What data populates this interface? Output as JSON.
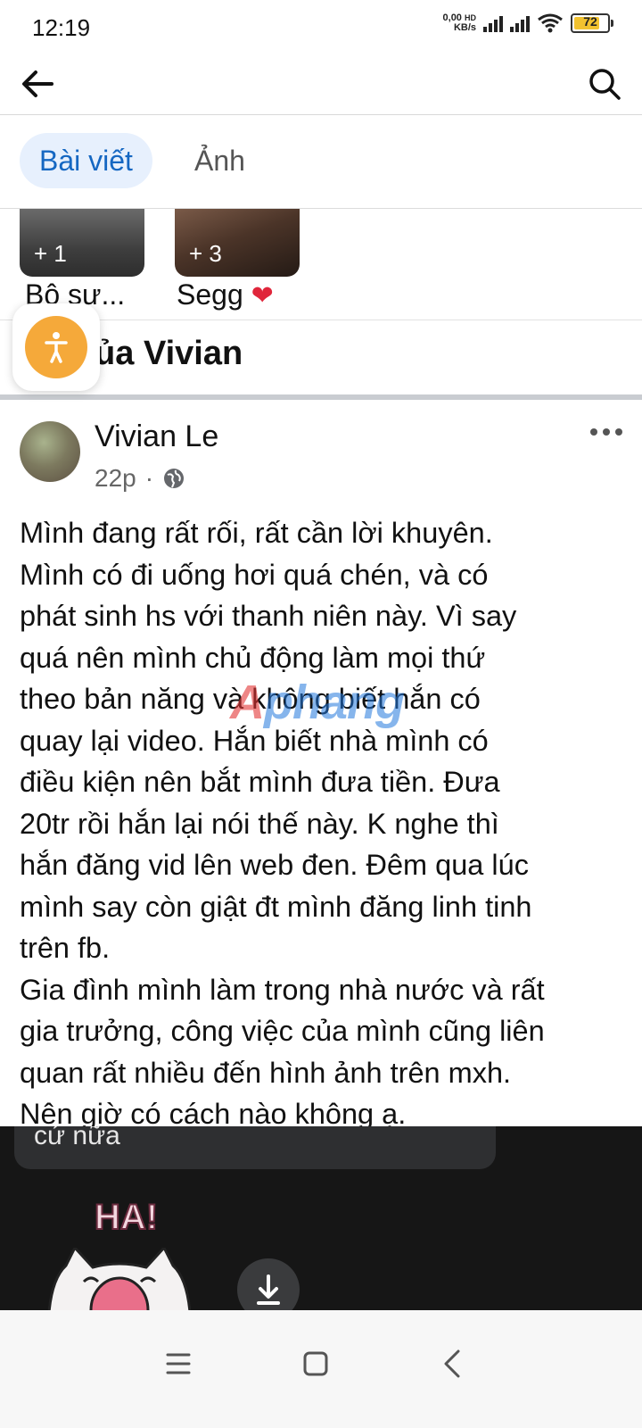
{
  "status_bar": {
    "time": "12:19",
    "net_speed_value": "0,00",
    "net_speed_unit": "KB/s",
    "network_type": "HD",
    "battery": "72",
    "icons": [
      "signal-icon",
      "signal-icon",
      "wifi-icon",
      "battery-icon"
    ]
  },
  "topbar": {
    "icons": [
      "back-arrow-icon",
      "search-icon"
    ]
  },
  "tabs": [
    {
      "label": "Bài viết",
      "active": true
    },
    {
      "label": "Ảnh",
      "active": false
    }
  ],
  "albums": [
    {
      "count": "+ 1",
      "name": "Bộ sư..."
    },
    {
      "count": "+ 3",
      "name": "Segg"
    }
  ],
  "section": {
    "title": "iết của Vivian"
  },
  "post": {
    "author": "Vivian Le",
    "time": "22p",
    "separator": "·",
    "privacy": "public",
    "body": "Mình đang rất rối, rất cần lời khuyên.\nMình có đi uống hơi quá chén, và có\nphát sinh hs với thanh niên này. Vì say\nquá nên mình chủ động làm mọi thứ\ntheo bản năng và không biết hắn có\nquay lại video. Hắn biết nhà mình có\nđiều kiện nên bắt mình đưa tiền. Đưa\n20tr rồi hắn lại nói thế này. K nghe thì\nhắn đăng vid lên web đen. Đêm qua lúc\nmình say còn giật đt mình đăng linh tinh\ntrên fb.\nGia đình mình làm trong nhà nước và rất\ngia trưởng, công việc của mình cũng liên\nquan rất nhiều đến hình ảnh trên mxh.\nNên giờ có cách nào không ạ."
  },
  "watermark": {
    "part1": "A",
    "part2": "phang"
  },
  "chat_overlay": {
    "bubble_text": "cứ nữa",
    "sticker_text": "HA!"
  },
  "colors": {
    "accent": "#1567c2",
    "tab_active_bg": "#e7f0fd",
    "accessibility_fab": "#f5a93a",
    "battery_fill": "#f2c230"
  }
}
